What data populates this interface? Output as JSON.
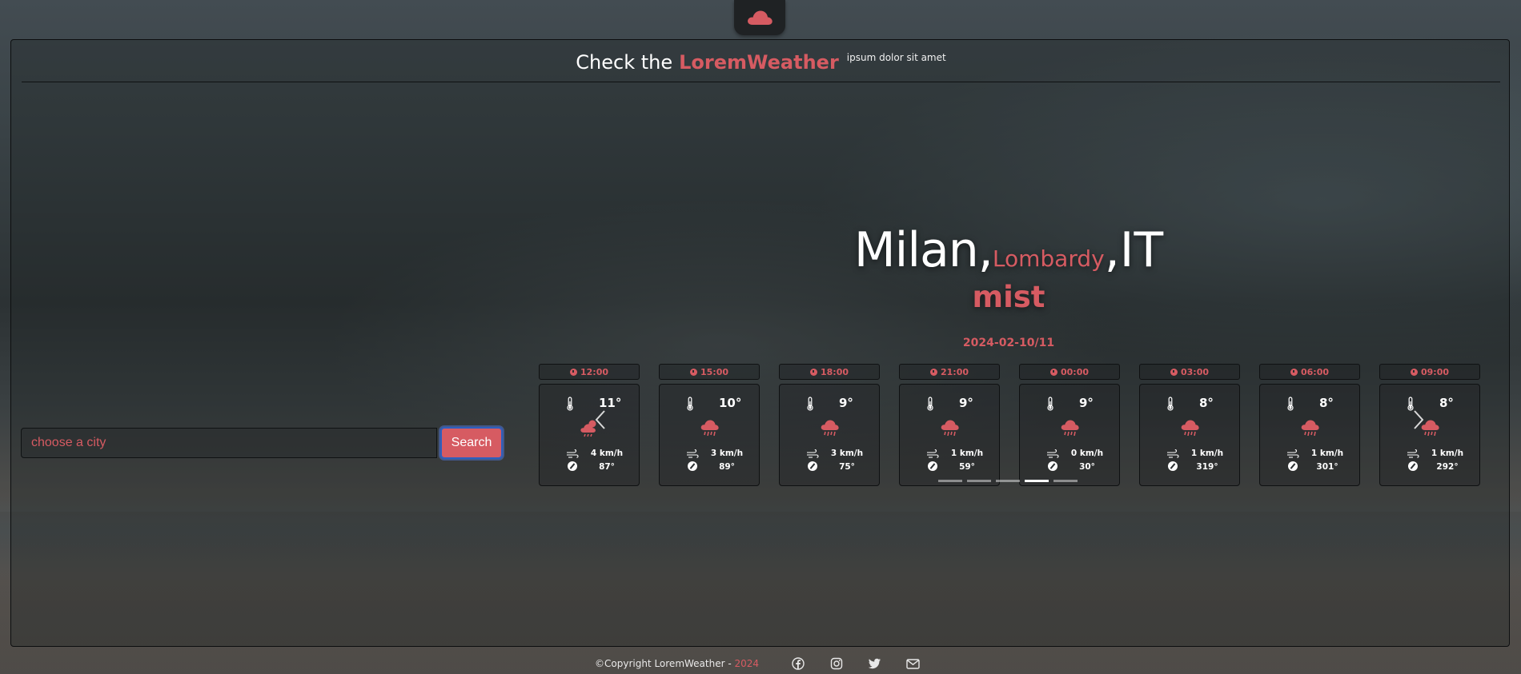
{
  "brand": {
    "prefix": "Check the",
    "name": "LoremWeather",
    "tagline": "ipsum dolor sit amet",
    "accent_color": "#d65b62",
    "logo_icon": "cloud-icon"
  },
  "search": {
    "placeholder": "choose a city",
    "value": "",
    "button_label": "Search"
  },
  "location": {
    "city": "Milan,",
    "region": "Lombardy",
    "country": ",IT",
    "condition": "mist",
    "date": "2024-02-10/11"
  },
  "forecast": [
    {
      "time": "12:00",
      "temp": "11°",
      "icon": "cloud-sun-rain-icon",
      "wind": "4 km/h",
      "direction": "87°"
    },
    {
      "time": "15:00",
      "temp": "10°",
      "icon": "cloud-rain-icon",
      "wind": "3 km/h",
      "direction": "89°"
    },
    {
      "time": "18:00",
      "temp": "9°",
      "icon": "cloud-rain-icon",
      "wind": "3 km/h",
      "direction": "75°"
    },
    {
      "time": "21:00",
      "temp": "9°",
      "icon": "cloud-rain-icon",
      "wind": "1 km/h",
      "direction": "59°"
    },
    {
      "time": "00:00",
      "temp": "9°",
      "icon": "cloud-rain-icon",
      "wind": "0 km/h",
      "direction": "30°"
    },
    {
      "time": "03:00",
      "temp": "8°",
      "icon": "cloud-rain-icon",
      "wind": "1 km/h",
      "direction": "319°"
    },
    {
      "time": "06:00",
      "temp": "8°",
      "icon": "cloud-rain-icon",
      "wind": "1 km/h",
      "direction": "301°"
    },
    {
      "time": "09:00",
      "temp": "8°",
      "icon": "cloud-rain-icon",
      "wind": "1 km/h",
      "direction": "292°"
    }
  ],
  "carousel": {
    "indicator_count": 5,
    "active_indicator": 4
  },
  "footer": {
    "copyright": "©Copyright LoremWeather - ",
    "year": "2024",
    "social_icons": [
      "facebook-icon",
      "instagram-icon",
      "twitter-icon",
      "mail-icon"
    ]
  }
}
